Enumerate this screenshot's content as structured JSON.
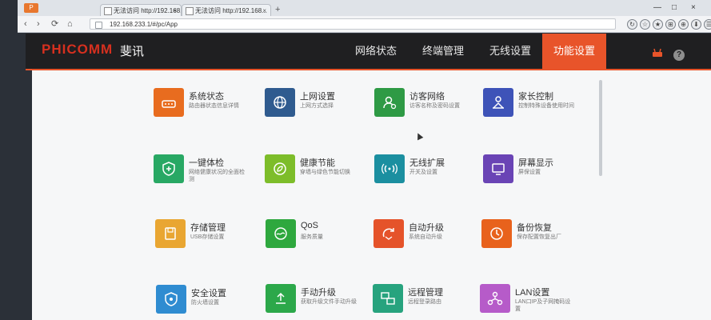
{
  "browser": {
    "brand_chip": "P",
    "tabs": [
      {
        "title": "无法访问 http://192.168..."
      },
      {
        "title": "无法访问 http://192.168..."
      }
    ],
    "new_tab": "+",
    "window_controls": [
      "—",
      "□",
      "×"
    ],
    "nav": {
      "back": "‹",
      "forward": "›",
      "reload": "⟳",
      "home": "⌂"
    },
    "url": "192.168.233.1/#/pc/App",
    "tools": [
      "↻",
      "☆",
      "★",
      "⊞",
      "⊕",
      "⬇",
      "☰",
      "≡"
    ]
  },
  "header": {
    "logo": "PHICOMM",
    "logo_cn": "斐讯",
    "menu": [
      {
        "label": "网络状态",
        "active": false
      },
      {
        "label": "终端管理",
        "active": false
      },
      {
        "label": "无线设置",
        "active": false
      },
      {
        "label": "功能设置",
        "active": true
      }
    ],
    "router_icon": "router-icon",
    "help_label": "?"
  },
  "tiles": [
    {
      "title": "系统状态",
      "subtitle": "路由器状态信息详情",
      "color": "#e86c1f",
      "icon": "router-icon"
    },
    {
      "title": "上网设置",
      "subtitle": "上网方式选择",
      "color": "#2f5b8f",
      "icon": "globe-icon"
    },
    {
      "title": "访客网络",
      "subtitle": "访客名称及密码设置",
      "color": "#2e9a45",
      "icon": "guest-icon"
    },
    {
      "title": "家长控制",
      "subtitle": "控制特殊设备使用时间",
      "color": "#3e53b8",
      "icon": "parent-icon"
    },
    {
      "title": "一键体检",
      "subtitle": "网络健康状况的全面检测",
      "color": "#28a864",
      "icon": "shield-plus-icon"
    },
    {
      "title": "健康节能",
      "subtitle": "穿墙与绿色节能切换",
      "color": "#7dbd2a",
      "icon": "leaf-icon"
    },
    {
      "title": "无线扩展",
      "subtitle": "开关及设置",
      "color": "#1b8fa0",
      "icon": "wireless-icon"
    },
    {
      "title": "屏幕显示",
      "subtitle": "屏保设置",
      "color": "#6a44b5",
      "icon": "screen-icon"
    },
    {
      "title": "存储管理",
      "subtitle": "USB存储设置",
      "color": "#e9a632",
      "icon": "storage-icon"
    },
    {
      "title": "QoS",
      "subtitle": "服务质量",
      "color": "#2ea83e",
      "icon": "qos-icon"
    },
    {
      "title": "自动升级",
      "subtitle": "系统自动升级",
      "color": "#e5532a",
      "icon": "upgrade-icon"
    },
    {
      "title": "备份恢复",
      "subtitle": "保存配置恢复出厂",
      "color": "#e8621c",
      "icon": "backup-icon"
    },
    {
      "title": "安全设置",
      "subtitle": "防火墙设置",
      "color": "#2f8cd1",
      "icon": "security-icon"
    },
    {
      "title": "手动升级",
      "subtitle": "获取升级文件手动升级",
      "color": "#2ca84a",
      "icon": "manual-upgrade-icon"
    },
    {
      "title": "远程管理",
      "subtitle": "远程登录路由",
      "color": "#27a37e",
      "icon": "remote-icon"
    },
    {
      "title": "LAN设置",
      "subtitle": "LAN口IP及子网掩码设置",
      "color": "#b65bc9",
      "icon": "lan-icon"
    }
  ]
}
